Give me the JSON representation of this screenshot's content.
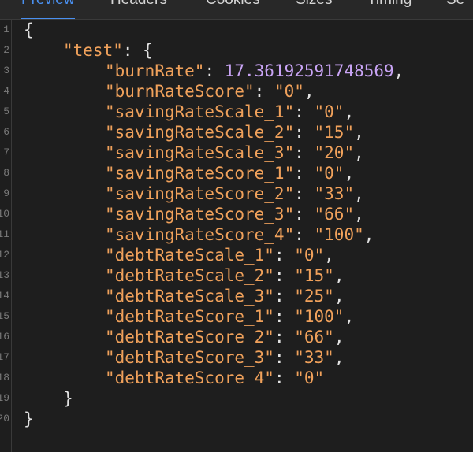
{
  "tabs": [
    {
      "label": "Preview",
      "active": true
    },
    {
      "label": "Headers",
      "active": false
    },
    {
      "label": "Cookies",
      "active": false
    },
    {
      "label": "Sizes",
      "active": false
    },
    {
      "label": "Timing",
      "active": false
    },
    {
      "label": "Se",
      "active": false
    }
  ],
  "line_numbers": [
    "1",
    "2",
    "3",
    "4",
    "5",
    "6",
    "7",
    "8",
    "9",
    "10",
    "11",
    "12",
    "13",
    "14",
    "15",
    "16",
    "17",
    "18",
    "19",
    "20"
  ],
  "json": {
    "root_open": "{",
    "root_close": "}",
    "object_key": "\"test\"",
    "object_open": ": {",
    "object_close": "}",
    "entries": [
      {
        "key": "\"burnRate\"",
        "value": "17.36192591748569",
        "type": "number",
        "comma": true
      },
      {
        "key": "\"burnRateScore\"",
        "value": "\"0\"",
        "type": "string",
        "comma": true
      },
      {
        "key": "\"savingRateScale_1\"",
        "value": "\"0\"",
        "type": "string",
        "comma": true
      },
      {
        "key": "\"savingRateScale_2\"",
        "value": "\"15\"",
        "type": "string",
        "comma": true
      },
      {
        "key": "\"savingRateScale_3\"",
        "value": "\"20\"",
        "type": "string",
        "comma": true
      },
      {
        "key": "\"savingRateScore_1\"",
        "value": "\"0\"",
        "type": "string",
        "comma": true
      },
      {
        "key": "\"savingRateScore_2\"",
        "value": "\"33\"",
        "type": "string",
        "comma": true
      },
      {
        "key": "\"savingRateScore_3\"",
        "value": "\"66\"",
        "type": "string",
        "comma": true
      },
      {
        "key": "\"savingRateScore_4\"",
        "value": "\"100\"",
        "type": "string",
        "comma": true
      },
      {
        "key": "\"debtRateScale_1\"",
        "value": "\"0\"",
        "type": "string",
        "comma": true
      },
      {
        "key": "\"debtRateScale_2\"",
        "value": "\"15\"",
        "type": "string",
        "comma": true
      },
      {
        "key": "\"debtRateScale_3\"",
        "value": "\"25\"",
        "type": "string",
        "comma": true
      },
      {
        "key": "\"debtRateScore_1\"",
        "value": "\"100\"",
        "type": "string",
        "comma": true
      },
      {
        "key": "\"debtRateScore_2\"",
        "value": "\"66\"",
        "type": "string",
        "comma": true
      },
      {
        "key": "\"debtRateScore_3\"",
        "value": "\"33\"",
        "type": "string",
        "comma": true
      },
      {
        "key": "\"debtRateScore_4\"",
        "value": "\"0\"",
        "type": "string",
        "comma": false
      }
    ]
  },
  "colors": {
    "background": "#1e1e1e",
    "key": "#f0a15b",
    "string": "#f0a15b",
    "number": "#c9a4f5",
    "punctuation": "#e2e2e2",
    "active_tab": "#4a90f0"
  }
}
